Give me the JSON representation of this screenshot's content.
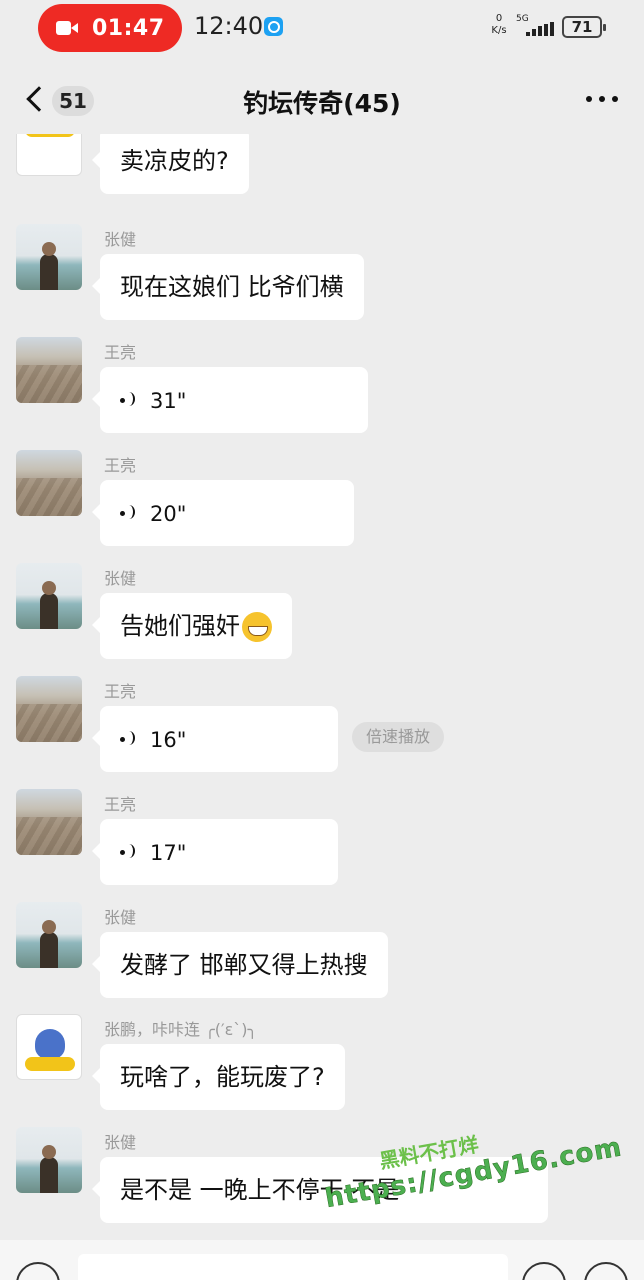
{
  "status_bar": {
    "record_time": "01:47",
    "clock": "12:40",
    "net_speed_value": "0",
    "net_speed_unit": "K/s",
    "network": "5G",
    "battery": "71"
  },
  "header": {
    "back_count": "51",
    "title": "钓坛传奇(45)"
  },
  "messages": [
    {
      "sender": "",
      "text": "卖凉皮的?"
    },
    {
      "sender": "张健",
      "text": "现在这娘们 比爷们横"
    },
    {
      "sender": "王亮",
      "duration": "31\""
    },
    {
      "sender": "王亮",
      "duration": "20\""
    },
    {
      "sender": "张健",
      "text": "告她们强奸",
      "emoji": "grin-emoji"
    },
    {
      "sender": "王亮",
      "duration": "16\"",
      "speed_chip": "倍速播放"
    },
    {
      "sender": "王亮",
      "duration": "17\""
    },
    {
      "sender": "张健",
      "text": "发酵了 邯郸又得上热搜"
    },
    {
      "sender": "张鹏，咔咔连 ╭(′ε`)╮",
      "text": "玩啥了，能玩废了?"
    },
    {
      "sender": "张健",
      "text": "是不是 一晚上不停干 不是"
    }
  ],
  "watermark": {
    "top": "黑料不打烊",
    "url": "https://cgdy16.com"
  },
  "colors": {
    "record_pill": "#ee2a24",
    "chat_background": "#ededed",
    "bubble": "#ffffff"
  }
}
